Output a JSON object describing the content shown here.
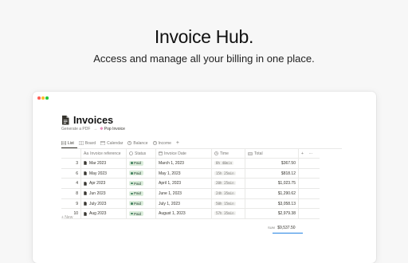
{
  "hero": {
    "title": "Invoice Hub.",
    "subtitle": "Access and manage all your billing in one place."
  },
  "page": {
    "title": "Invoices",
    "breadcrumb_generate": "Generate a PDF",
    "breadcrumb_arrow": "→",
    "breadcrumb_pop": "Pop Invoice"
  },
  "tabs": [
    {
      "label": "List",
      "icon": "list-icon"
    },
    {
      "label": "Board",
      "icon": "board-icon"
    },
    {
      "label": "Calendar",
      "icon": "calendar-icon"
    },
    {
      "label": "Balance",
      "icon": "balance-icon"
    },
    {
      "label": "Income",
      "icon": "income-icon"
    }
  ],
  "tab_add": "+",
  "table": {
    "headers": {
      "ref": "Invoice reference",
      "status": "Status",
      "date": "Invoice Date",
      "time": "Time",
      "total": "Total",
      "add": "+",
      "more": "···"
    },
    "rows": [
      {
        "num": "3",
        "ref": "Mar 2023",
        "status": "Paid",
        "date": "March 1, 2023",
        "time": "8h 40min",
        "total": "$367.50"
      },
      {
        "num": "6",
        "ref": "May 2023",
        "status": "Paid",
        "date": "May 1, 2023",
        "time": "15h 25min",
        "total": "$818.12"
      },
      {
        "num": "4",
        "ref": "Apr 2023",
        "status": "Paid",
        "date": "April 1, 2023",
        "time": "20h 25min",
        "total": "$1,023.75"
      },
      {
        "num": "8",
        "ref": "Jun 2023",
        "status": "Paid",
        "date": "June 1, 2023",
        "time": "24h 35min",
        "total": "$1,290.62"
      },
      {
        "num": "9",
        "ref": "July 2023",
        "status": "Paid",
        "date": "July 1, 2023",
        "time": "50h 15min",
        "total": "$3,058.13"
      },
      {
        "num": "10",
        "ref": "Aug 2023",
        "status": "Paid",
        "date": "August 1, 2023",
        "time": "57h 35min",
        "total": "$2,979.38"
      }
    ],
    "new_label": "+ New",
    "sum_label": "SUM",
    "sum_value": "$9,537.50"
  },
  "colors": {
    "paid_bg": "#dbeddb",
    "paid_dot": "#448361",
    "accent": "#2383e2"
  }
}
